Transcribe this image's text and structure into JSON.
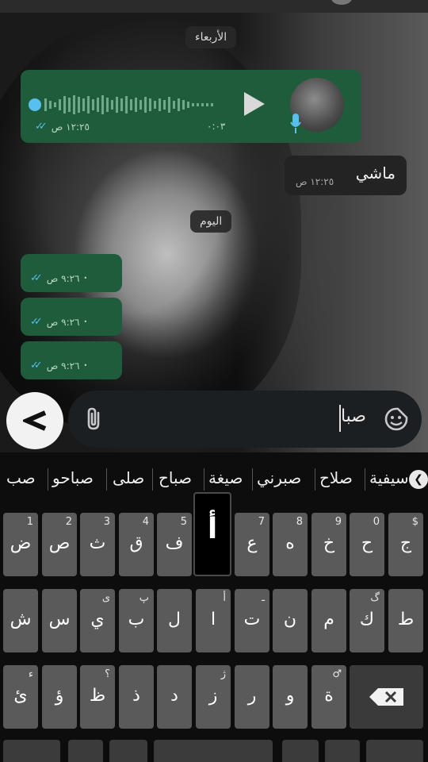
{
  "chat": {
    "date_wednesday": "الأربعاء",
    "voice": {
      "duration": "٠:٠٣",
      "time": "١٢:٢٥ ص"
    },
    "incoming": {
      "text": "ماشي",
      "time": "١٢:٢٥ ص"
    },
    "date_today": "اليوم",
    "outgoing": [
      {
        "time": "٩:٢٦ ص"
      },
      {
        "time": "٩:٢٦ ص"
      },
      {
        "time": "٩:٢٦ ص"
      }
    ]
  },
  "input": {
    "text": "صبا"
  },
  "suggestions": [
    "صب",
    "صباحو",
    "صلى",
    "صباح",
    "صيغة",
    "صبرني",
    "صلاح",
    "سيفية"
  ],
  "keyboard": {
    "row1": [
      {
        "main": "ض",
        "sub": "1"
      },
      {
        "main": "ص",
        "sub": "2"
      },
      {
        "main": "ث",
        "sub": "3"
      },
      {
        "main": "ق",
        "sub": "4"
      },
      {
        "main": "ف",
        "sub": "5"
      },
      {
        "main": "",
        "sub": ""
      },
      {
        "main": "ع",
        "sub": "7"
      },
      {
        "main": "ه",
        "sub": "8"
      },
      {
        "main": "خ",
        "sub": "9"
      },
      {
        "main": "ح",
        "sub": "0"
      },
      {
        "main": "ج",
        "sub": "$"
      }
    ],
    "popup": "أ",
    "row2": [
      {
        "main": "ش",
        "sub": ""
      },
      {
        "main": "س",
        "sub": ""
      },
      {
        "main": "ي",
        "sub": "ى"
      },
      {
        "main": "ب",
        "sub": "پ"
      },
      {
        "main": "ل",
        "sub": ""
      },
      {
        "main": "ا",
        "sub": "أ"
      },
      {
        "main": "ت",
        "sub": "ـ"
      },
      {
        "main": "ن",
        "sub": ""
      },
      {
        "main": "م",
        "sub": ""
      },
      {
        "main": "ك",
        "sub": "گ"
      },
      {
        "main": "ط",
        "sub": ""
      }
    ],
    "row3": [
      {
        "main": "ئ",
        "sub": "ء"
      },
      {
        "main": "ؤ",
        "sub": ""
      },
      {
        "main": "ظ",
        "sub": "؟"
      },
      {
        "main": "ذ",
        "sub": ""
      },
      {
        "main": "د",
        "sub": ""
      },
      {
        "main": "ز",
        "sub": "ژ"
      },
      {
        "main": "ر",
        "sub": ""
      },
      {
        "main": "و",
        "sub": ""
      },
      {
        "main": "ة",
        "sub": "♂"
      }
    ]
  }
}
